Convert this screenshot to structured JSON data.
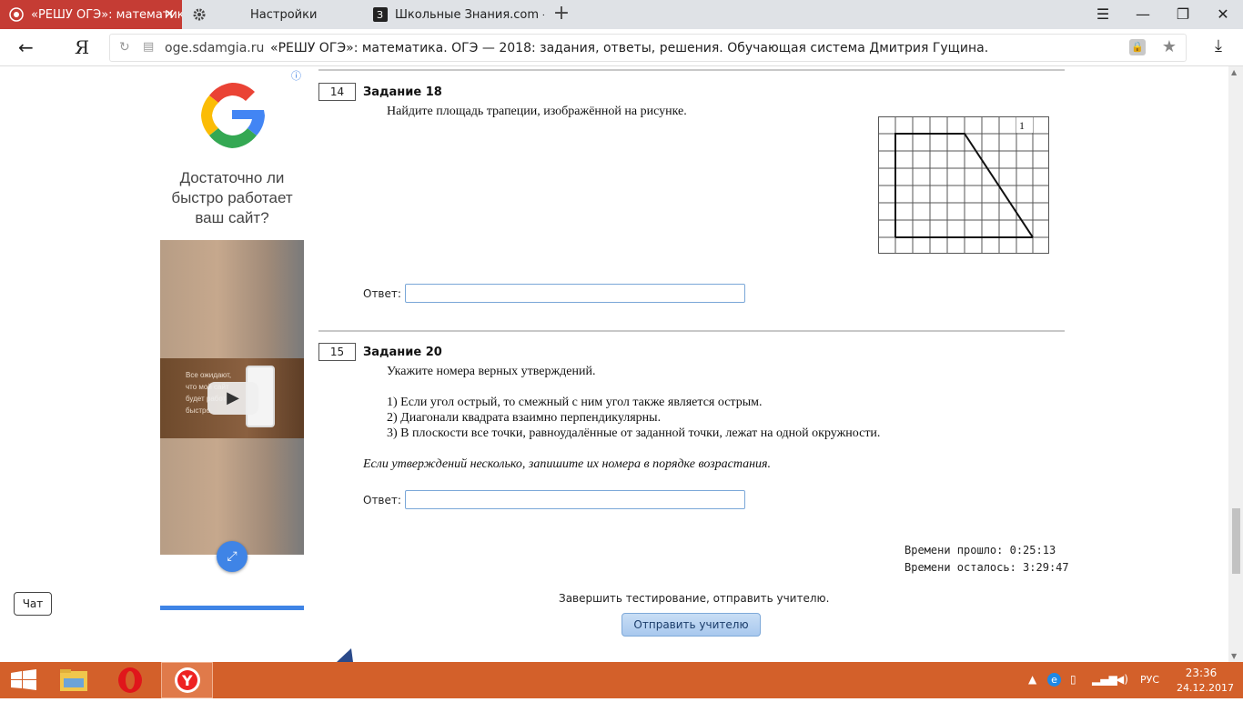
{
  "browser": {
    "tabs": [
      {
        "label": "«РЕШУ ОГЭ»: математика",
        "active": true
      },
      {
        "label": "Настройки",
        "active": false
      },
      {
        "label": "Школьные Знания.com - Ре",
        "active": false
      }
    ],
    "new_tab_symbol": "+",
    "url_domain": "oge.sdamgia.ru",
    "url_title": "«РЕШУ ОГЭ»: математика. ОГЭ — 2018: задания, ответы, решения. Обучающая система Дмитрия Гущина.",
    "ya_label": "Я"
  },
  "ad": {
    "text": "Достаточно ли быстро работает ваш сайт?",
    "video_text": "Все ожидают, что мой сайт будет работать быстро.",
    "info_symbol": "i",
    "colors": {
      "google_blue": "#4285F4",
      "google_red": "#EA4335",
      "google_yellow": "#FBBC05",
      "google_green": "#34A853"
    }
  },
  "chat": {
    "label": "Чат"
  },
  "tasks": [
    {
      "number": "14",
      "title": "Задание 18",
      "question": "Найдите площадь трапеции, изображённой на рисунке.",
      "figure_label": "1",
      "answer_label": "Ответ:",
      "answer_value": ""
    },
    {
      "number": "15",
      "title": "Задание 20",
      "question": "Укажите номера верных утверждений.",
      "statements": [
        "1) Если угол острый, то смежный с ним угол также является острым.",
        "2) Диагонали квадрата взаимно перпендикулярны.",
        "3) В плоскости все точки, равноудалённые от заданной точки, лежат на одной окружности."
      ],
      "note": "Если утверждений несколько, запишите их номера в порядке возрастания.",
      "answer_label": "Ответ:",
      "answer_value": ""
    }
  ],
  "timers": {
    "elapsed": "Времени прошло:   0:25:13",
    "remaining": "Времени осталось: 3:29:47"
  },
  "finish": {
    "text": "Завершить тестирование, отправить учителю.",
    "button_label": "Отправить учителю"
  },
  "taskbar": {
    "lang": "РУС",
    "time": "23:36",
    "date": "24.12.2017",
    "color": "#d3602a"
  }
}
